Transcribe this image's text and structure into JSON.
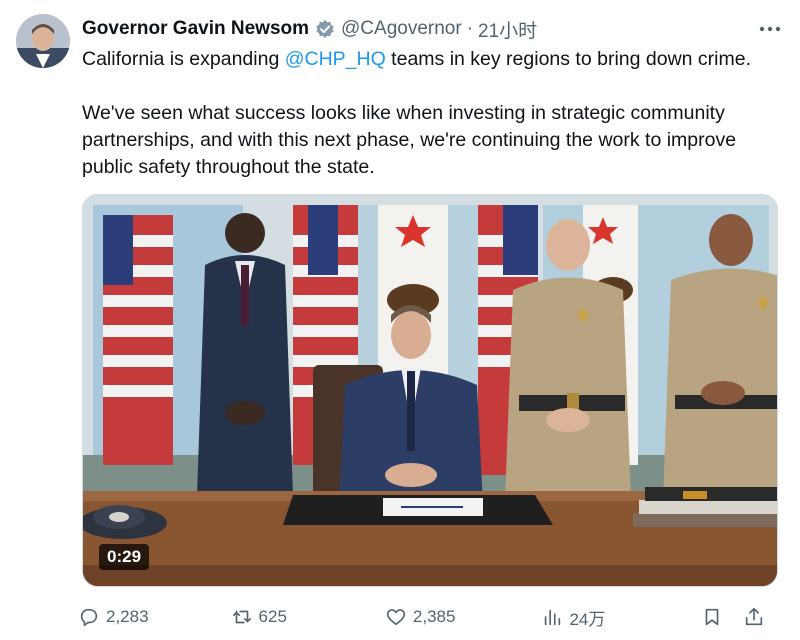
{
  "author": {
    "display_name": "Governor Gavin Newsom",
    "handle": "@CAgovernor",
    "separator": "·",
    "time": "21小时",
    "verified_color": "#829aab"
  },
  "tweet": {
    "line1_prefix": "California is expanding ",
    "mention": "@CHP_HQ",
    "line1_suffix": " teams in key regions to bring down crime.",
    "paragraph2": "We've seen what success looks like when investing in strategic community partnerships, and with this next phase, we're continuing the work to improve public safety throughout the state."
  },
  "media": {
    "duration": "0:29"
  },
  "actions": {
    "reply_count": "2,283",
    "retweet_count": "625",
    "like_count": "2,385",
    "views_count": "24万"
  },
  "colors": {
    "link": "#1d9bf0",
    "secondary_text": "#536471"
  }
}
